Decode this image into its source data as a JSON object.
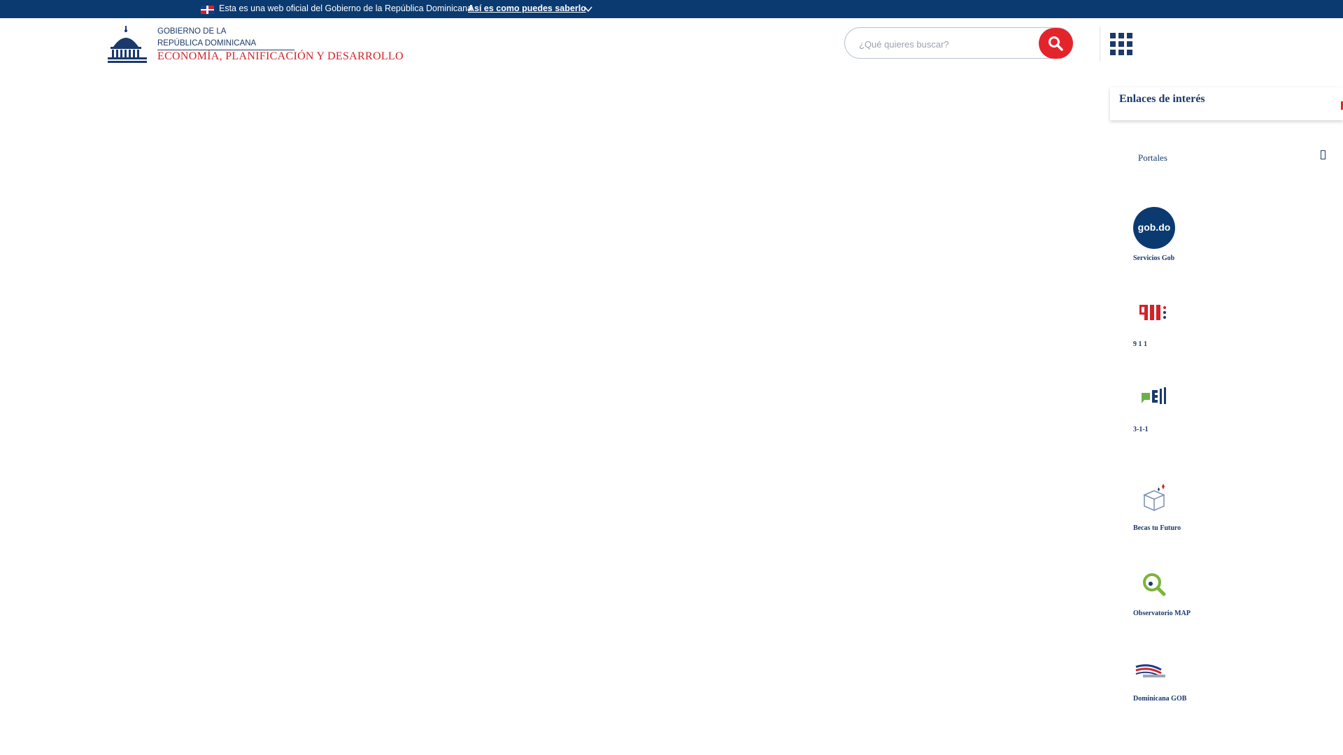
{
  "topbar": {
    "text": "Esta es una web oficial del Gobierno de la República Dominicana",
    "link": "Así es como puedes saberlo"
  },
  "logo": {
    "line1": "GOBIERNO DE LA",
    "line2": "REPÚBLICA DOMINICANA",
    "line3": "ECONOMÍA, PLANIFICACIÓN Y DESARROLLO"
  },
  "search": {
    "placeholder": "¿Qué quieres buscar?"
  },
  "panel": {
    "title": "Enlaces de interés",
    "section": "Portales"
  },
  "portals": [
    {
      "label": "Servicios Gob",
      "icon": "gob-do-icon"
    },
    {
      "label": "9 1 1",
      "icon": "911-icon"
    },
    {
      "label": "3-1-1",
      "icon": "311-icon"
    },
    {
      "label": "Becas tu Futuro",
      "icon": "becas-icon"
    },
    {
      "label": "Observatorio MAP",
      "icon": "observatorio-icon"
    },
    {
      "label": "Dominicana GOB",
      "icon": "dominicana-gob-icon"
    }
  ],
  "gob_badge_text": "gob.do",
  "colors": {
    "topbar": "#0b3a70",
    "brand_blue": "#1b3a6b",
    "accent_red": "#e4242b"
  }
}
